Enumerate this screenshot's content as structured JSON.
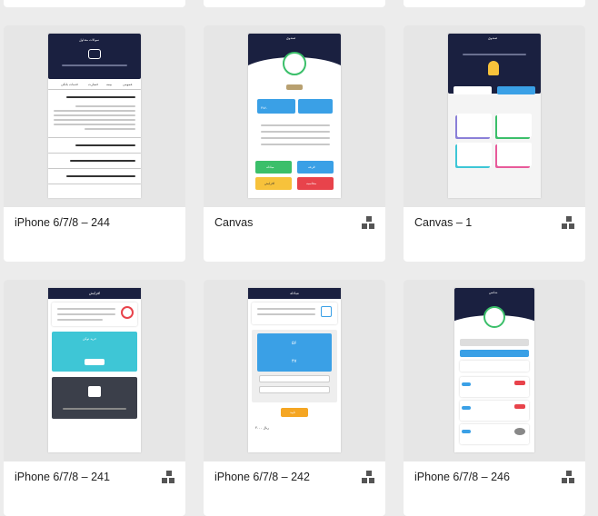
{
  "cards": [
    {
      "title": "iPhone 6/7/8 – 244",
      "has_component_icon": false
    },
    {
      "title": "Canvas",
      "has_component_icon": true
    },
    {
      "title": "Canvas – 1",
      "has_component_icon": true
    },
    {
      "title": "iPhone 6/7/8 – 241",
      "has_component_icon": true
    },
    {
      "title": "iPhone 6/7/8 – 242",
      "has_component_icon": true
    },
    {
      "title": "iPhone 6/7/8 – 246",
      "has_component_icon": true
    }
  ],
  "screens": {
    "s244": {
      "header": "سوالات متداول",
      "tabs": [
        "عمومی",
        "بیمه",
        "خسارت",
        "خدمات بانکی"
      ]
    },
    "s_canvas": {
      "header": "صندوق",
      "buttons": [
        "مبادله",
        "قرعه",
        "افزایش",
        "محاسبه"
      ],
      "value": "۳۸۷۰"
    },
    "s_canvas1": {
      "header": "صندوق",
      "label": "خرید بلیط"
    },
    "s241": {
      "header": "افزایش",
      "cta": "خرید توکن"
    },
    "s242": {
      "header": "مبادله",
      "big1": "۵۶",
      "big2": "۴۷",
      "button": "تایید",
      "footer": "۳۰۰۰ ریال"
    },
    "s246": {
      "header": "شانس"
    }
  },
  "colors": {
    "navy": "#1a2040",
    "green": "#3bbf6a",
    "orange": "#f5a623",
    "blue": "#3aa0e6",
    "red": "#e8434b",
    "yellow": "#f7c23b",
    "teal": "#3ec6d6"
  }
}
